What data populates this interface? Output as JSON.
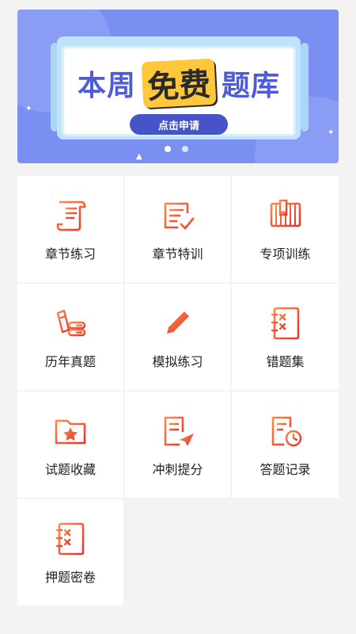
{
  "banner": {
    "title_left": "本周",
    "title_highlight": "免费",
    "title_right": "题库",
    "button_label": "点击申请",
    "dots_active_index": 0
  },
  "colors": {
    "banner_bg": "#7b8ff3",
    "icon_orange": "#f25a2b",
    "icon_red": "#e8322b",
    "icon_gradient_from": "#ff7a45",
    "icon_gradient_to": "#e8322b",
    "highlight_yellow": "#ffc83a",
    "title_blue": "#4d5cd6"
  },
  "tiles": [
    {
      "label": "章节练习",
      "icon": "scroll-document-icon"
    },
    {
      "label": "章节特训",
      "icon": "checklist-icon"
    },
    {
      "label": "专项训练",
      "icon": "book-stack-icon"
    },
    {
      "label": "历年真题",
      "icon": "archive-files-icon"
    },
    {
      "label": "模拟练习",
      "icon": "pencil-lines-icon"
    },
    {
      "label": "错题集",
      "icon": "mistakes-notebook-icon"
    },
    {
      "label": "试题收藏",
      "icon": "star-folder-icon"
    },
    {
      "label": "冲刺提分",
      "icon": "paper-plane-doc-icon"
    },
    {
      "label": "答题记录",
      "icon": "clock-doc-icon"
    },
    {
      "label": "押题密卷",
      "icon": "secret-paper-icon"
    }
  ]
}
